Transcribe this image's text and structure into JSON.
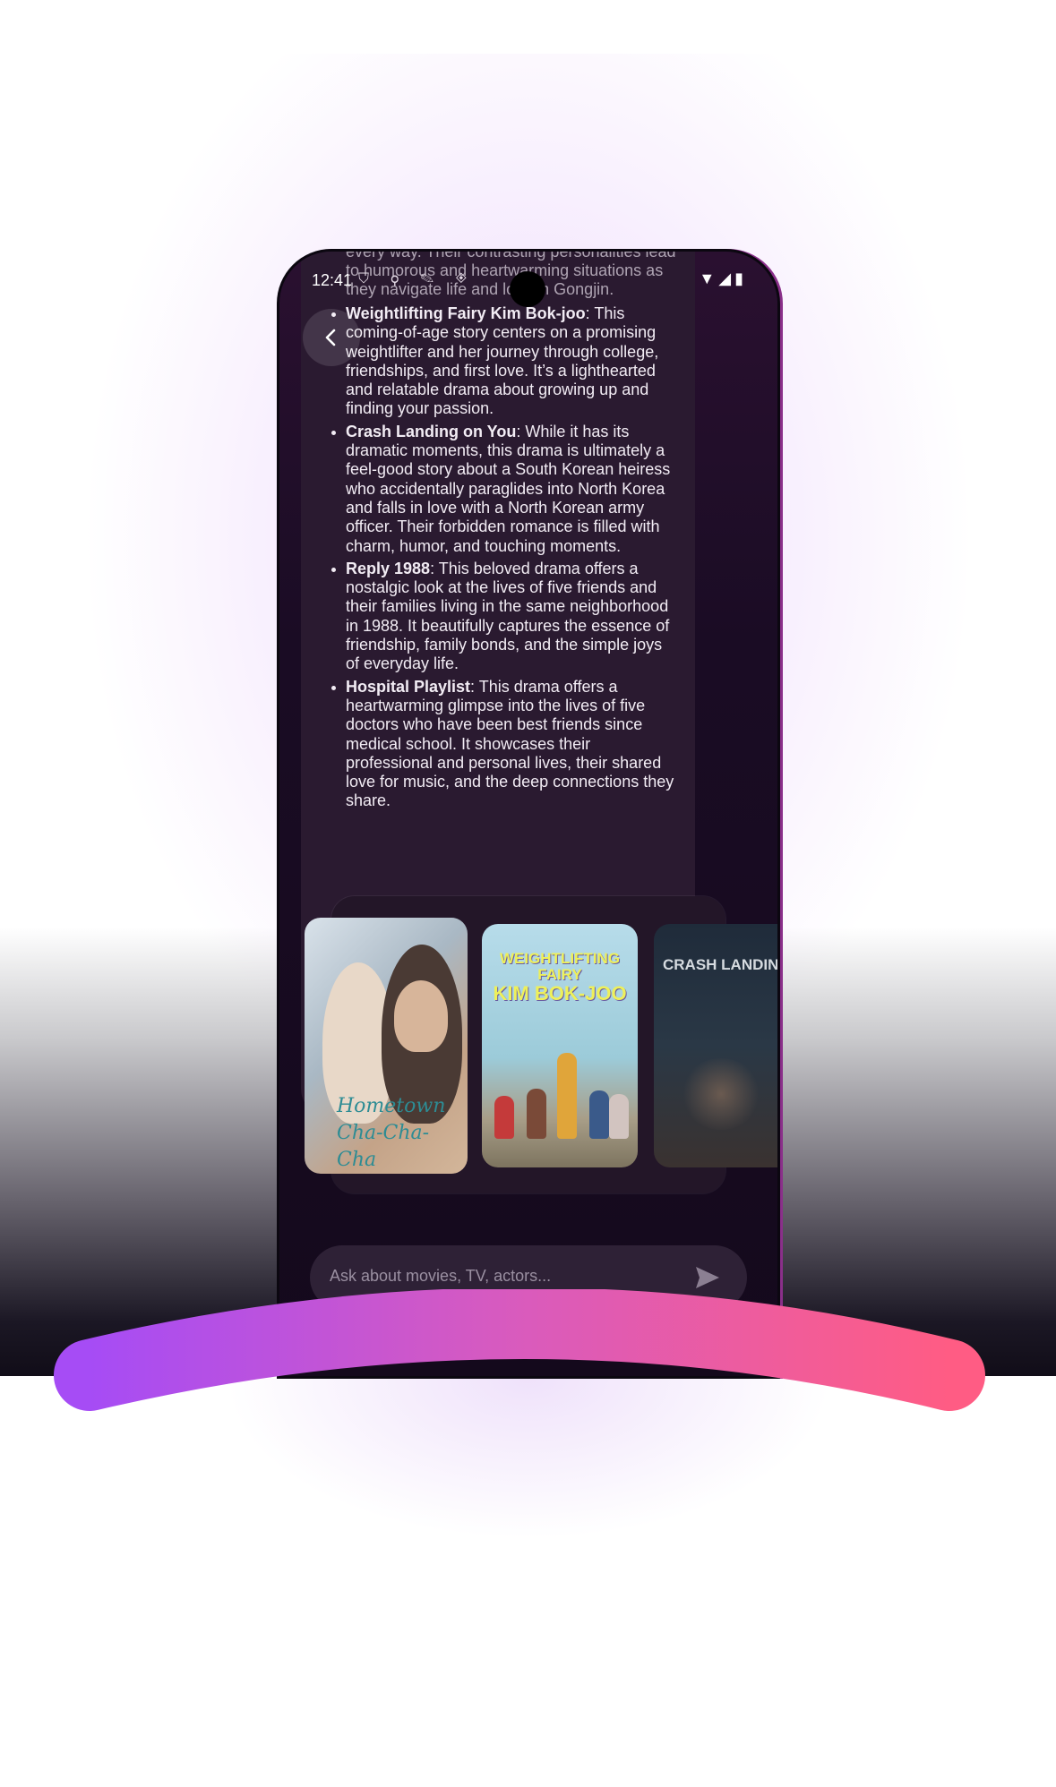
{
  "status": {
    "time": "12:41",
    "left_icons": "⛉ ⚲ ✎ ◈",
    "right_icons": "▼◢▮"
  },
  "message": {
    "lead": "every way. Their contrasting personalities lead to humorous and heartwarming situations as they navigate life and love in Gongjin.",
    "items": [
      {
        "title": "Weightlifting Fairy Kim Bok-joo",
        "text": ": This coming-of-age story centers on a promising weightlifter and her journey through college, friendships, and first love. It’s a lighthearted and relatable drama about growing up and finding your passion."
      },
      {
        "title": "Crash Landing on You",
        "text": ": While it has its dramatic moments, this drama is ultimately a feel-good story about a South Korean heiress who accidentally paraglides into North Korea and falls in love with a North Korean army officer. Their forbidden romance is filled with charm, humor, and touching moments."
      },
      {
        "title": "Reply 1988",
        "text": ": This beloved drama offers a nostalgic look at the lives of five friends and their families living in the same neighborhood in 1988. It beautifully captures the essence of friendship, family bonds, and the simple joys of everyday life."
      },
      {
        "title": "Hospital Playlist",
        "text": ": This drama offers a heartwarming glimpse into the lives of five doctors who have been best friends since medical school. It showcases their professional and personal lives, their shared love for music, and the deep connections they share."
      }
    ]
  },
  "posters": [
    {
      "title": "Hometown Cha-Cha-Cha"
    },
    {
      "title_top": "WEIGHTLIFTING FAIRY",
      "title_bottom": "KIM BOK-JOO"
    },
    {
      "title": "CRASH LANDING O"
    }
  ],
  "input": {
    "placeholder": "Ask about movies, TV, actors..."
  },
  "icons": {
    "back": "chevron-left-icon",
    "send": "send-icon"
  },
  "colors": {
    "arc_start": "#a64cf5",
    "arc_end": "#ff5c84"
  }
}
